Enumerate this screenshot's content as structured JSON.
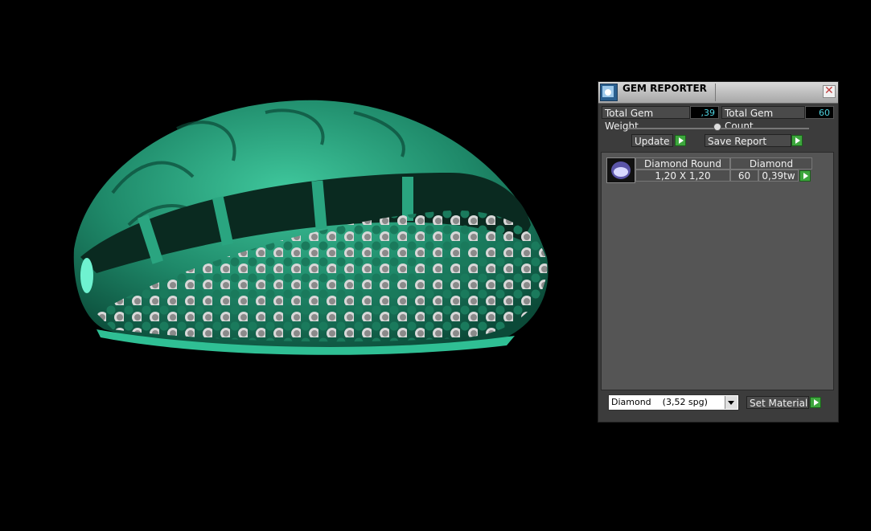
{
  "panel": {
    "title": "GEM REPORTER",
    "total_weight_label": "Total Gem Weight",
    "total_weight_value": ",39",
    "total_count_label": "Total Gem Count",
    "total_count_value": "60",
    "update_label": "Update",
    "save_report_label": "Save Report",
    "set_material_label": "Set Material",
    "material_selected": "Diamond    (3,52 spg)",
    "accent_color": "#3da63d"
  },
  "gems": [
    {
      "shape": "Diamond Round",
      "material": "Diamond",
      "size": "1,20 X 1,20",
      "count": "60",
      "weight": "0,39tw"
    }
  ],
  "model": {
    "type": "jewelry-ring-render",
    "color": "#1f8a6a"
  }
}
